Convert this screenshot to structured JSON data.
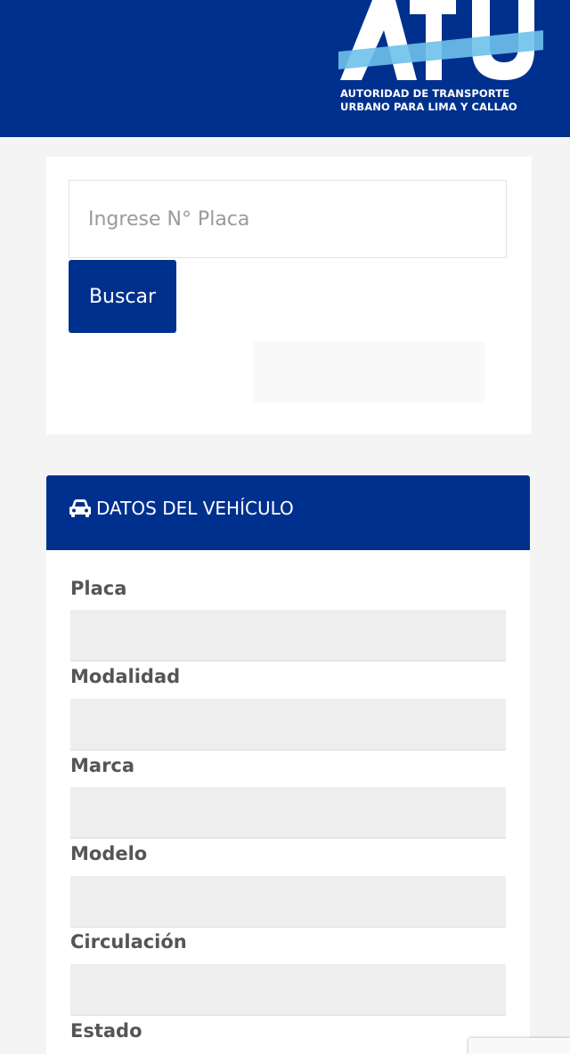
{
  "header": {
    "logo_line1": "AUTORIDAD DE TRANSPORTE",
    "logo_line2": "URBANO PARA LIMA Y CALLAO"
  },
  "search": {
    "placeholder": "Ingrese N° Placa",
    "value": "",
    "button_label": "Buscar"
  },
  "vehicle": {
    "icon": "car-icon",
    "title": "DATOS DEL VEHÍCULO",
    "fields": [
      {
        "label": "Placa",
        "value": ""
      },
      {
        "label": "Modalidad",
        "value": ""
      },
      {
        "label": "Marca",
        "value": ""
      },
      {
        "label": "Modelo",
        "value": ""
      },
      {
        "label": "Circulación",
        "value": ""
      },
      {
        "label": "Estado",
        "value": ""
      }
    ]
  },
  "colors": {
    "brand_blue": "#00308d",
    "logo_light_blue": "#6ec1ea",
    "background": "#f4f4f4",
    "field_background": "#eeeeee"
  }
}
